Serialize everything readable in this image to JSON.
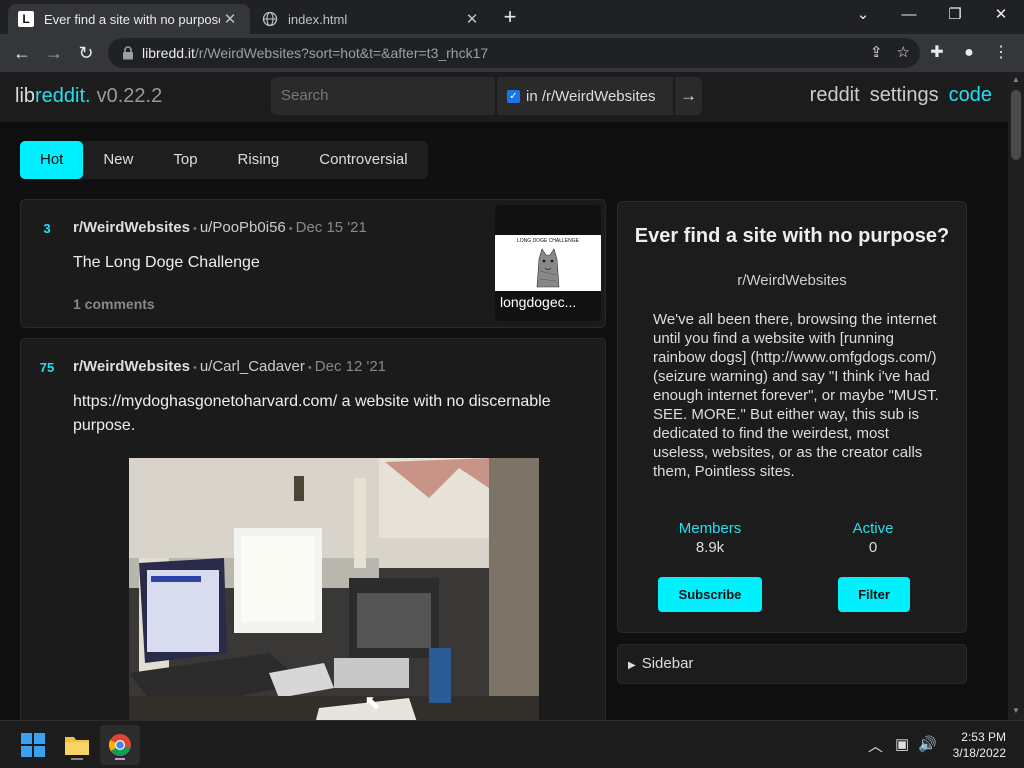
{
  "browser": {
    "tabs": [
      {
        "title": "Ever find a site with no purpose?",
        "active": true
      },
      {
        "title": "index.html",
        "active": false
      }
    ],
    "url_host": "libredd.it",
    "url_path": "/r/WeirdWebsites?sort=hot&t=&after=t3_rhck17"
  },
  "nav": {
    "brand_lib": "lib",
    "brand_reddit": "reddit.",
    "version": "v0.22.2",
    "search_placeholder": "Search",
    "restrict_label": "in /r/WeirdWebsites",
    "links": [
      "reddit",
      "settings",
      "code"
    ]
  },
  "sort": {
    "tabs": [
      "Hot",
      "New",
      "Top",
      "Rising",
      "Controversial"
    ],
    "active": "Hot"
  },
  "posts": [
    {
      "score": "3",
      "subreddit": "r/WeirdWebsites",
      "author": "u/PooPb0i56",
      "date": "Dec 15 '21",
      "title": "The Long Doge Challenge",
      "comments": "1 comments",
      "thumb_label": "longdogec...",
      "thumb_caption": "LONG DOGE CHALLENGE"
    },
    {
      "score": "75",
      "subreddit": "r/WeirdWebsites",
      "author": "u/Carl_Cadaver",
      "date": "Dec 12 '21",
      "title": "https://mydoghasgonetoharvard.com/ a website with no discernable purpose."
    }
  ],
  "about": {
    "title": "Ever find a site with no purpose?",
    "name": "r/WeirdWebsites",
    "description": "We've all been there, browsing the internet until you find a website with [running rainbow dogs] (http://www.omfgdogs.com/) (seizure warning) and say \"I think i've had enough internet forever\", or maybe \"MUST. SEE. MORE.\" But either way, this sub is dedicated to find the weirdest, most useless, websites, or as the creator calls them, Pointless sites.",
    "members_label": "Members",
    "members_value": "8.9k",
    "active_label": "Active",
    "active_value": "0",
    "subscribe_label": "Subscribe",
    "filter_label": "Filter",
    "sidebar_label": "Sidebar"
  },
  "taskbar": {
    "time": "2:53 PM",
    "date": "3/18/2022"
  },
  "colors": {
    "accent": "#00f0ff",
    "background": "#0f0f0f",
    "panel": "#1b1b1b"
  }
}
